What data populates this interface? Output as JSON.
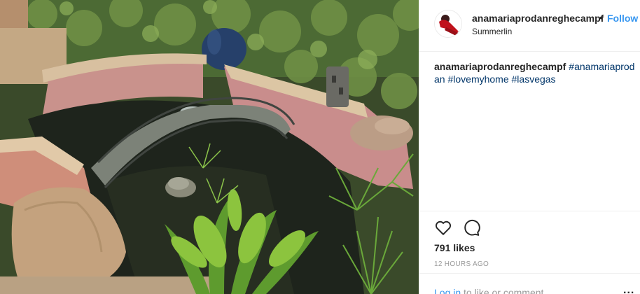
{
  "post": {
    "username": "anamariaprodanreghecampf",
    "separator": "•",
    "follow_label": "Follow",
    "location": "Summerlin",
    "caption_user": "anamariaprodanreghecampf",
    "hashtags": [
      "#anamariaprodan",
      "#lovemyhome",
      "#lasvegas"
    ],
    "likes": "791 likes",
    "timestamp": "12 HOURS AGO",
    "login_link": "Log in",
    "login_rest": " to like or comment.",
    "more_label": "..."
  },
  "icons": {
    "like": "heart-icon",
    "comment": "comment-bubble-icon",
    "avatar": "user-avatar"
  },
  "colors": {
    "follow": "#3897f0",
    "hashtag": "#003569",
    "muted": "#999999",
    "text": "#262626"
  }
}
